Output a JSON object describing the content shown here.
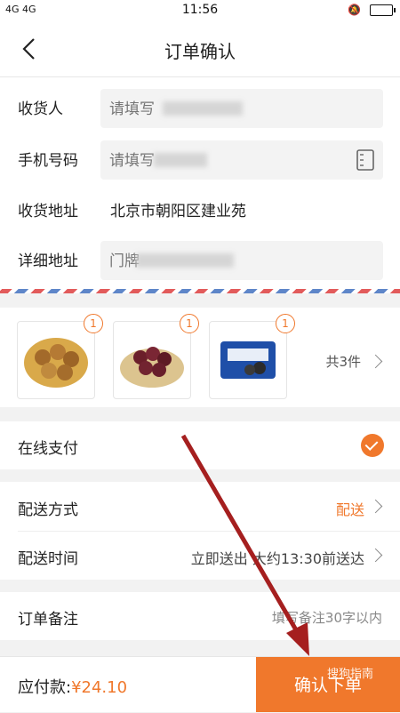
{
  "status": {
    "left": "4G  4G",
    "time": "11:56"
  },
  "nav": {
    "title": "订单确认"
  },
  "form": {
    "receiver_label": "收货人",
    "receiver_placeholder": "请填写",
    "phone_label": "手机号码",
    "phone_placeholder": "请填写",
    "address_label": "收货地址",
    "address_value": "北京市朝阳区建业苑",
    "detail_label": "详细地址",
    "detail_placeholder": "门牌"
  },
  "products": {
    "items": [
      {
        "name": "hazelnuts",
        "qty": "1"
      },
      {
        "name": "grapes",
        "qty": "1"
      },
      {
        "name": "cookies",
        "qty": "1"
      }
    ],
    "count_text": "共3件"
  },
  "payment": {
    "label": "在线支付",
    "selected": true
  },
  "delivery": {
    "method_label": "配送方式",
    "method_value": "配送",
    "time_label": "配送时间",
    "time_value": "立即送出 大约13:30前送达"
  },
  "note": {
    "label": "订单备注",
    "hint": "填写备注30字以内"
  },
  "footer": {
    "pay_label": "应付款:",
    "pay_amount": "¥24.10",
    "submit_label": "确认下单",
    "watermark": "搜狗指南"
  },
  "colors": {
    "accent": "#f0782c",
    "arrow": "#a51f1f"
  }
}
